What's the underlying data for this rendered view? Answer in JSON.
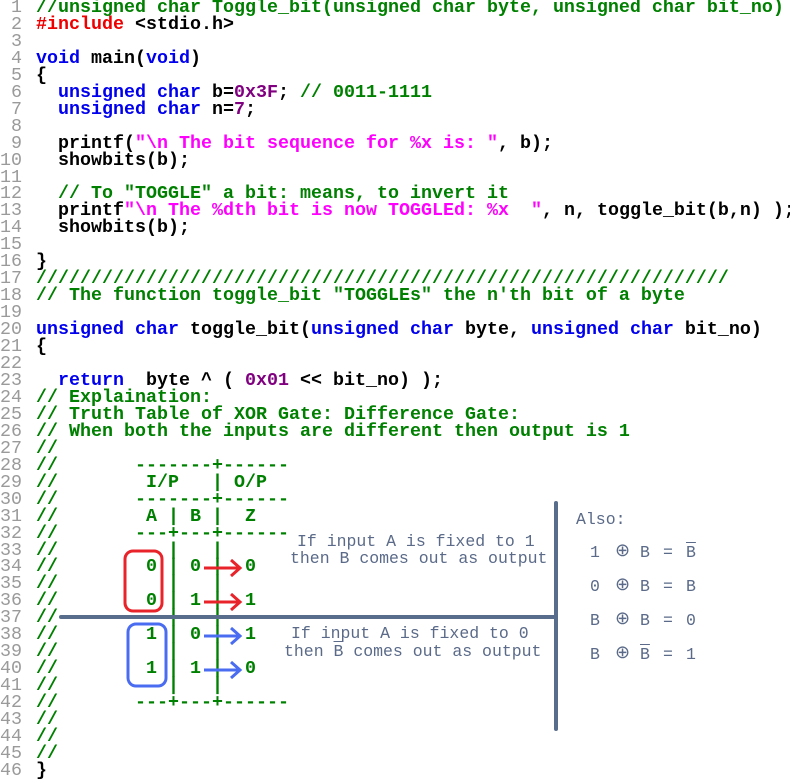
{
  "editor": {
    "lines": [
      [
        [
          "c",
          "//unsigned char Toggle_bit(unsigned char byte, unsigned char bit_no)"
        ]
      ],
      [
        [
          "p",
          "#include"
        ],
        [
          "t",
          " <stdio.h>"
        ]
      ],
      [],
      [
        [
          "k",
          "void"
        ],
        [
          "t",
          " main("
        ],
        [
          "k",
          "void"
        ],
        [
          "t",
          ")"
        ]
      ],
      [
        [
          "t",
          "{"
        ]
      ],
      [
        [
          "t",
          "  "
        ],
        [
          "k",
          "unsigned char"
        ],
        [
          "t",
          " b="
        ],
        [
          "n",
          "0x3F"
        ],
        [
          "t",
          "; "
        ],
        [
          "c",
          "// 0011-1111"
        ]
      ],
      [
        [
          "t",
          "  "
        ],
        [
          "k",
          "unsigned char"
        ],
        [
          "t",
          " n="
        ],
        [
          "n",
          "7"
        ],
        [
          "t",
          ";"
        ]
      ],
      [],
      [
        [
          "t",
          "  printf("
        ],
        [
          "s",
          "\"\\n The bit sequence for %x is: \""
        ],
        [
          "t",
          ", b);"
        ]
      ],
      [
        [
          "t",
          "  showbits(b);"
        ]
      ],
      [],
      [
        [
          "t",
          "  "
        ],
        [
          "c",
          "// To \"TOGGLE\" a bit: means, to invert it"
        ]
      ],
      [
        [
          "t",
          "  printf"
        ],
        [
          "s",
          "\"\\n The %dth bit is now TOGGLEd: %x  \""
        ],
        [
          "t",
          ", n, toggle_bit(b,n) );"
        ]
      ],
      [
        [
          "t",
          "  showbits(b);"
        ]
      ],
      [],
      [
        [
          "t",
          "}"
        ]
      ],
      [
        [
          "c",
          "///////////////////////////////////////////////////////////////"
        ]
      ],
      [
        [
          "c",
          "// The function toggle_bit \"TOGGLEs\" the n'th bit of a byte"
        ]
      ],
      [],
      [
        [
          "k",
          "unsigned char"
        ],
        [
          "t",
          " toggle_bit("
        ],
        [
          "k",
          "unsigned char"
        ],
        [
          "t",
          " byte, "
        ],
        [
          "k",
          "unsigned char"
        ],
        [
          "t",
          " bit_no)"
        ]
      ],
      [
        [
          "t",
          "{"
        ]
      ],
      [],
      [
        [
          "t",
          "  "
        ],
        [
          "k",
          "return"
        ],
        [
          "t",
          "  byte ^ ( "
        ],
        [
          "n",
          "0x01"
        ],
        [
          "t",
          " << bit_no) );"
        ]
      ],
      [
        [
          "c",
          "// Explaination:"
        ]
      ],
      [
        [
          "c",
          "// Truth Table of XOR Gate: Difference Gate:"
        ]
      ],
      [
        [
          "c",
          "// When both the inputs are different then output is 1"
        ]
      ],
      [
        [
          "c",
          "//"
        ]
      ],
      [
        [
          "c",
          "//       -------+------"
        ]
      ],
      [
        [
          "c",
          "//        I/P   | O/P"
        ]
      ],
      [
        [
          "c",
          "//       -------+------"
        ]
      ],
      [
        [
          "c",
          "//        A | B |  Z"
        ]
      ],
      [
        [
          "c",
          "//       ---+---+------"
        ]
      ],
      [
        [
          "c",
          "//          |   |"
        ]
      ],
      [
        [
          "c",
          "//        0 | 0 |  0"
        ]
      ],
      [
        [
          "c",
          "//          |   |"
        ]
      ],
      [
        [
          "c",
          "//        0 | 1 |  1"
        ]
      ],
      [
        [
          "c",
          "//          |   |"
        ]
      ],
      [
        [
          "c",
          "//        1 | 0 |  1"
        ]
      ],
      [
        [
          "c",
          "//          |   |"
        ]
      ],
      [
        [
          "c",
          "//        1 | 1 |  0"
        ]
      ],
      [
        [
          "c",
          "//          |   |"
        ]
      ],
      [
        [
          "c",
          "//       ---+---+------"
        ]
      ],
      [
        [
          "c",
          "//"
        ]
      ],
      [
        [
          "c",
          "//"
        ]
      ],
      [
        [
          "c",
          "//"
        ]
      ],
      [
        [
          "t",
          "}"
        ]
      ]
    ]
  },
  "colors": {
    "comment": "#008000",
    "keyword": "#0000ee",
    "preprocessor": "#ee0000",
    "string": "#ff00ff",
    "number": "#800080",
    "annotation": "#586c8c",
    "box_a0": "#e8232a",
    "box_a1": "#4a6cf0"
  },
  "annotations": {
    "note1_line1": "If input A is fixed to 1",
    "note1_line2_pre": "then ",
    "note1_line2_b": "B",
    "note1_line2_post": " comes out as output",
    "note2_line1": "If input A is fixed to 0",
    "note2_line2_pre": "then ",
    "note2_line2_b": "B",
    "note2_line2_post": " comes out as output",
    "also_title": "Also:",
    "identities": [
      {
        "left": "1",
        "op": "⊕",
        "right": "B",
        "right_bar": false,
        "eq": "=",
        "result": "B",
        "result_bar": true
      },
      {
        "left": "0",
        "op": "⊕",
        "right": "B",
        "right_bar": false,
        "eq": "=",
        "result": "B",
        "result_bar": false
      },
      {
        "left": "B",
        "op": "⊕",
        "right": "B",
        "right_bar": false,
        "eq": "=",
        "result": "0",
        "result_bar": false
      },
      {
        "left": "B",
        "op": "⊕",
        "right": "B",
        "right_bar": true,
        "eq": "=",
        "result": "1",
        "result_bar": false
      }
    ]
  }
}
